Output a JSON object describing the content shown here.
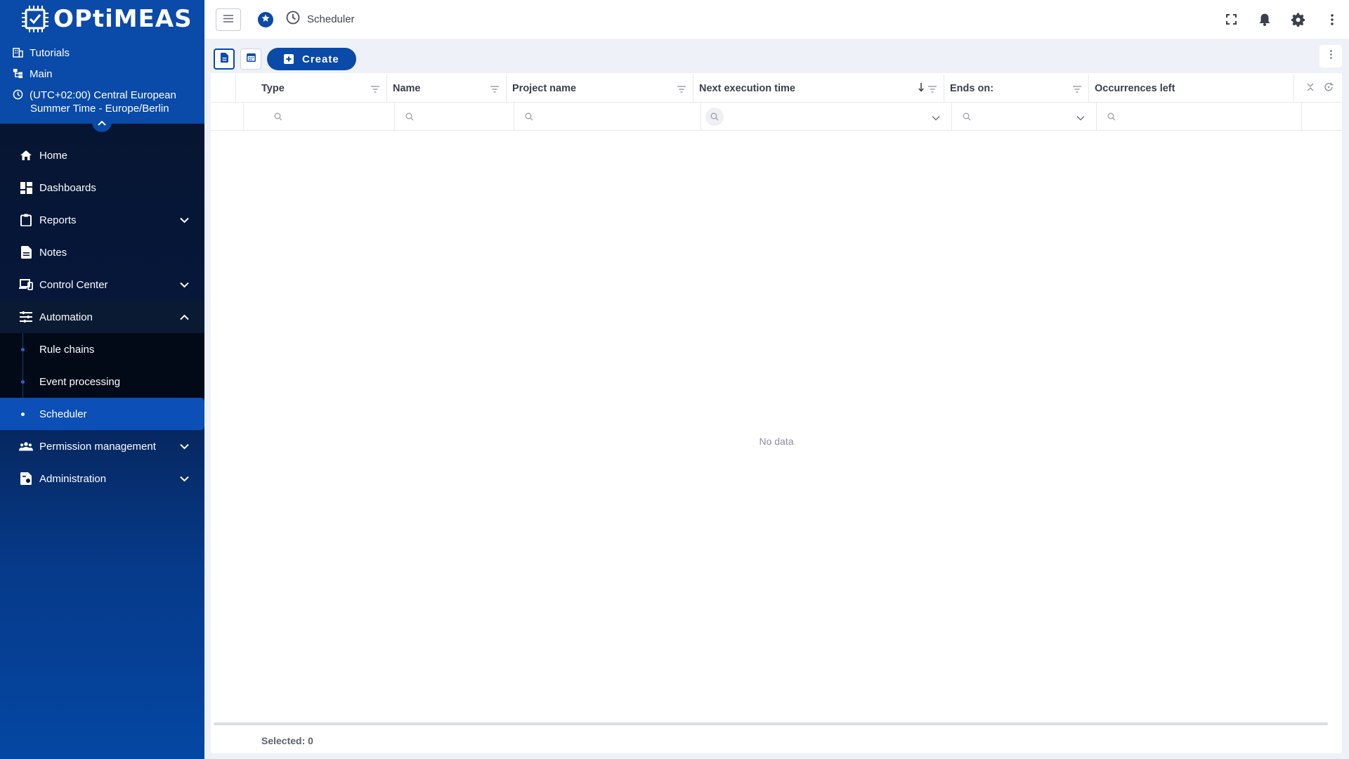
{
  "brand": {
    "name": "OPtiMEAS"
  },
  "context": {
    "tutorials": "Tutorials",
    "main": "Main",
    "timezone_line1": "(UTC+02:00) Central European",
    "timezone_line2": "Summer Time - Europe/Berlin"
  },
  "nav": {
    "home": "Home",
    "dashboards": "Dashboards",
    "reports": "Reports",
    "notes": "Notes",
    "control_center": "Control Center",
    "automation": "Automation",
    "rule_chains": "Rule chains",
    "event_processing": "Event processing",
    "scheduler": "Scheduler",
    "permission_management": "Permission management",
    "administration": "Administration"
  },
  "header": {
    "breadcrumb": "Scheduler"
  },
  "toolbar": {
    "create_label": "Create"
  },
  "table": {
    "columns": [
      "Type",
      "Name",
      "Project name",
      "Next execution time",
      "Ends on:",
      "Occurrences left"
    ],
    "sort": {
      "column": "Next execution time",
      "direction": "desc"
    },
    "rows": [],
    "empty_text": "No data"
  },
  "footer": {
    "selected": "Selected: 0"
  },
  "colors": {
    "brand": "#0a4aa8",
    "sidebar_dark": "#06142c",
    "active": "#0c4fb6"
  }
}
